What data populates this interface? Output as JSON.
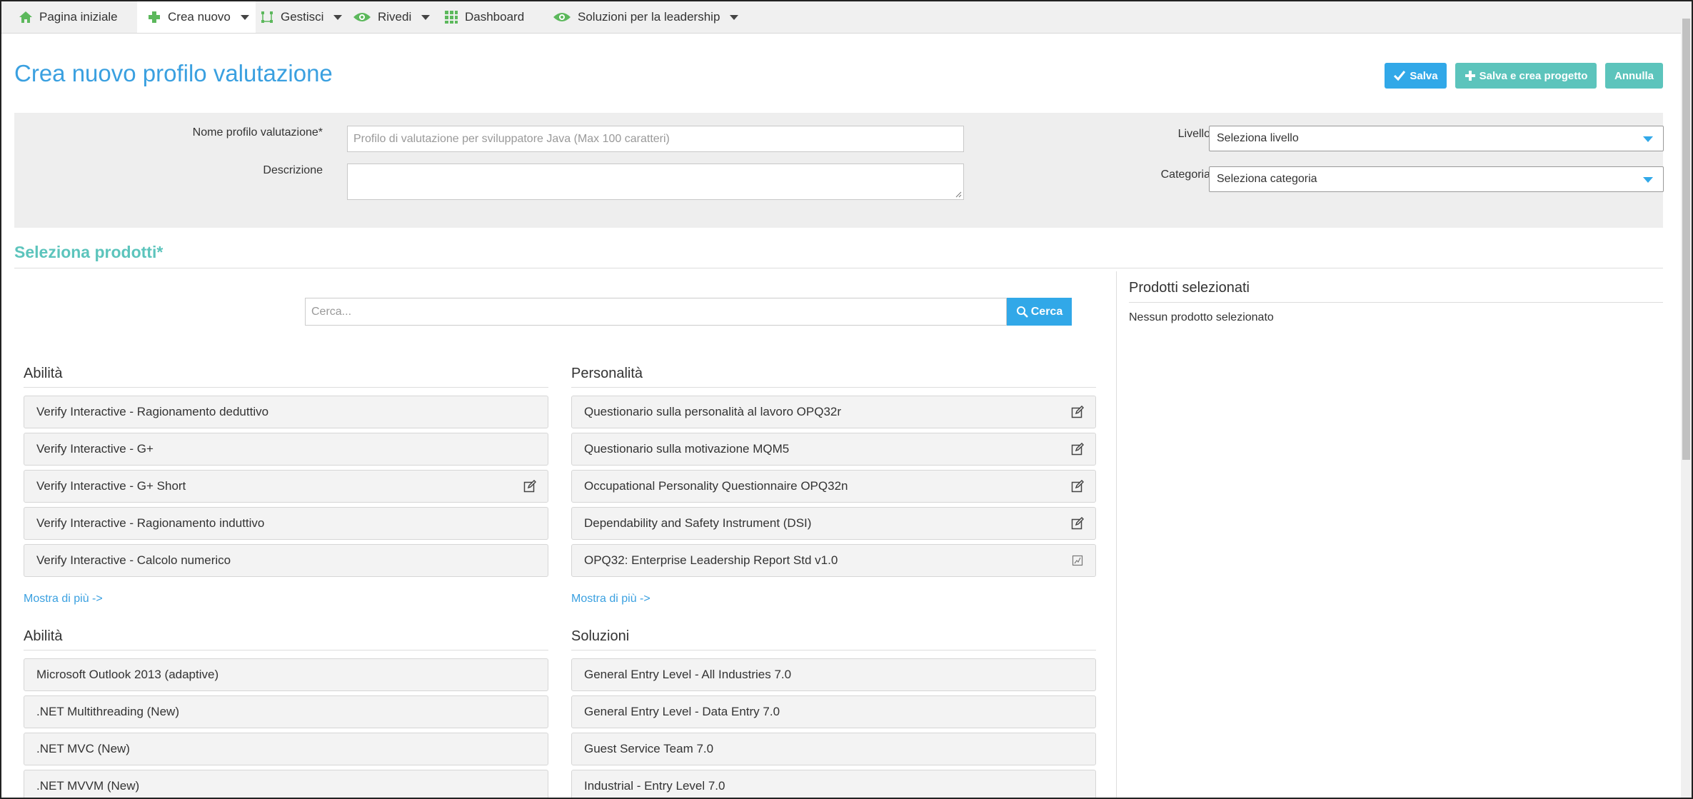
{
  "nav": {
    "items": [
      {
        "label": "Pagina iniziale"
      },
      {
        "label": "Crea nuovo"
      },
      {
        "label": "Gestisci"
      },
      {
        "label": "Rivedi"
      },
      {
        "label": "Dashboard"
      },
      {
        "label": "Soluzioni per la leadership"
      }
    ]
  },
  "header": {
    "title": "Crea nuovo profilo valutazione",
    "save_label": "Salva",
    "save_project_label": "Salva e crea progetto",
    "cancel_label": "Annulla"
  },
  "form": {
    "name_label": "Nome profilo valutazione*",
    "name_placeholder": "Profilo di valutazione per sviluppatore Java (Max 100 caratteri)",
    "description_label": "Descrizione",
    "level_label": "Livello",
    "level_value": "Seleziona livello",
    "category_label": "Categoria",
    "category_value": "Seleziona categoria"
  },
  "products": {
    "section_title": "Seleziona prodotti*",
    "search_placeholder": "Cerca...",
    "search_button": "Cerca",
    "groups": [
      {
        "title": "Abilità",
        "items": [
          "Verify Interactive - Ragionamento deduttivo",
          "Verify Interactive - G+",
          "Verify Interactive - G+ Short",
          "Verify Interactive - Ragionamento induttivo",
          "Verify Interactive - Calcolo numerico"
        ],
        "more": "Mostra di più ->"
      },
      {
        "title": "Personalità",
        "items": [
          "Questionario sulla personalità al lavoro OPQ32r",
          "Questionario sulla motivazione MQM5",
          "Occupational Personality Questionnaire OPQ32n",
          "Dependability and Safety Instrument (DSI)",
          "OPQ32: Enterprise Leadership Report Std v1.0"
        ],
        "more": "Mostra di più ->"
      },
      {
        "title": "Abilità",
        "items": [
          "Microsoft Outlook 2013 (adaptive)",
          ".NET Multithreading (New)",
          ".NET MVC (New)",
          ".NET MVVM (New)"
        ]
      },
      {
        "title": "Soluzioni",
        "items": [
          "General Entry Level - All Industries 7.0",
          "General Entry Level - Data Entry 7.0",
          "Guest Service Team 7.0",
          "Industrial - Entry Level 7.0"
        ]
      }
    ],
    "selected_title": "Prodotti selezionati",
    "selected_empty": "Nessun prodotto selezionato"
  },
  "colors": {
    "accent_blue": "#31a8e8",
    "accent_teal": "#5cc4bc",
    "icon_green": "#5cb85c"
  }
}
